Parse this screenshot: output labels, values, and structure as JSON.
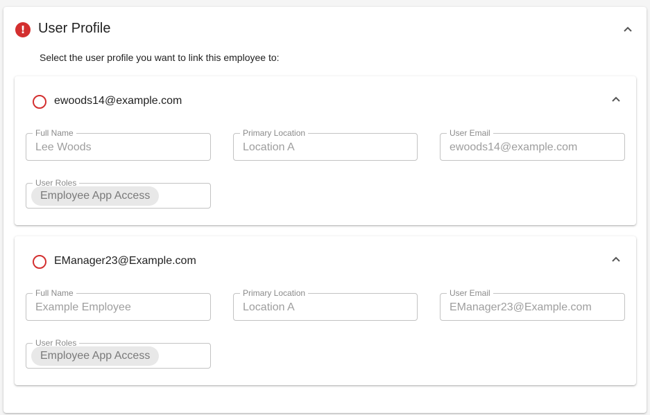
{
  "panel": {
    "title": "User Profile",
    "status_icon": "error-icon",
    "expand_icon": "chevron-up-icon",
    "instruction": "Select the user profile you want to link this employee to:",
    "accent_color": "#d32f2f"
  },
  "profiles": [
    {
      "email": "ewoods14@example.com",
      "selected": false,
      "fields": {
        "full_name": {
          "label": "Full Name",
          "value": "Lee Woods"
        },
        "primary_location": {
          "label": "Primary Location",
          "value": "Location A"
        },
        "user_email": {
          "label": "User Email",
          "value": "ewoods14@example.com"
        },
        "user_roles": {
          "label": "User Roles",
          "chips": [
            "Employee App Access"
          ]
        }
      }
    },
    {
      "email": "EManager23@Example.com",
      "selected": false,
      "fields": {
        "full_name": {
          "label": "Full Name",
          "value": "Example Employee"
        },
        "primary_location": {
          "label": "Primary Location",
          "value": "Location A"
        },
        "user_email": {
          "label": "User Email",
          "value": "EManager23@Example.com"
        },
        "user_roles": {
          "label": "User Roles",
          "chips": [
            "Employee App Access"
          ]
        }
      }
    }
  ]
}
